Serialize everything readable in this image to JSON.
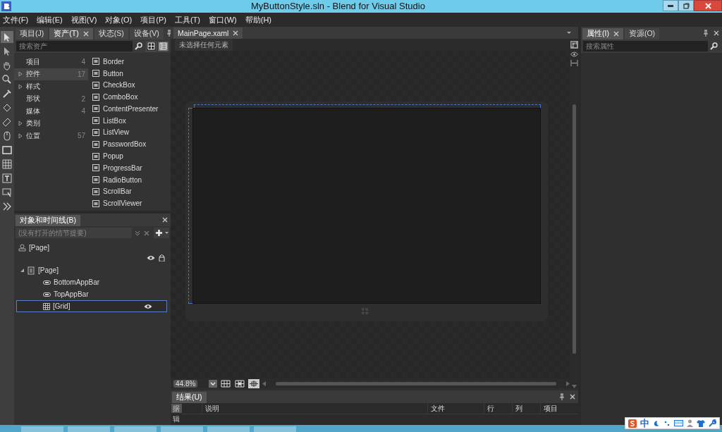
{
  "window": {
    "title": "MyButtonStyle.sln - Blend for Visual Studio"
  },
  "menu": [
    "文件(F)",
    "编辑(E)",
    "视图(V)",
    "对象(O)",
    "项目(P)",
    "工具(T)",
    "窗口(W)",
    "帮助(H)"
  ],
  "assets_panel": {
    "tabs": [
      {
        "label": "项目(J)",
        "selected": false
      },
      {
        "label": "资产(T)",
        "selected": true
      },
      {
        "label": "状态(S)",
        "selected": false
      },
      {
        "label": "设备(V)",
        "selected": false
      }
    ],
    "search": {
      "placeholder": "搜索资产"
    },
    "view_toggles": [
      {
        "kind": "grid",
        "selected": false
      },
      {
        "kind": "list",
        "selected": true
      }
    ],
    "categories": [
      {
        "label": "项目",
        "count": "4",
        "expandable": false,
        "selected": false
      },
      {
        "label": "控件",
        "count": "17",
        "expandable": true,
        "selected": true
      },
      {
        "label": "样式",
        "expandable": true,
        "selected": false
      },
      {
        "label": "形状",
        "count": "2",
        "expandable": false,
        "selected": false
      },
      {
        "label": "媒体",
        "count": "4",
        "expandable": false,
        "selected": false
      },
      {
        "label": "类别",
        "expandable": true,
        "selected": false
      },
      {
        "label": "位置",
        "count": "57",
        "expandable": true,
        "selected": false
      }
    ],
    "assets": [
      "Border",
      "Button",
      "CheckBox",
      "ComboBox",
      "ContentPresenter",
      "ListBox",
      "ListView",
      "PasswordBox",
      "Popup",
      "ProgressBar",
      "RadioButton",
      "ScrollBar",
      "ScrollViewer"
    ]
  },
  "objects_panel": {
    "title": "对象和时间线(B)",
    "storyboard": {
      "placeholder": "(没有打开的情节提要)"
    },
    "scope": "[Page]",
    "tree": [
      {
        "label": "[Page]",
        "expanded": true,
        "selected": false,
        "children": [
          {
            "label": "BottomAppBar",
            "selected": false
          },
          {
            "label": "TopAppBar",
            "selected": false
          },
          {
            "label": "[Grid]",
            "selected": true
          }
        ]
      }
    ]
  },
  "document": {
    "tab": "MainPage.xaml",
    "breadcrumb": "未选择任何元素",
    "zoom": "44.8%",
    "view_buttons": [
      {
        "kind": "grid",
        "selected": false
      },
      {
        "kind": "snap-grid",
        "selected": false
      },
      {
        "kind": "snap-lines",
        "selected": true
      }
    ]
  },
  "results_panel": {
    "title": "结果(U)",
    "side_tabs": [
      {
        "label": "据",
        "selected": true
      },
      {
        "label": "辑",
        "selected": false
      }
    ],
    "columns": [
      "说明",
      "文件",
      "行",
      "列",
      "项目"
    ]
  },
  "properties_panel": {
    "tabs": [
      {
        "label": "属性(I)",
        "selected": true
      },
      {
        "label": "资源(O)",
        "selected": false
      }
    ],
    "search": {
      "placeholder": "搜索属性"
    }
  },
  "ime_bar": {
    "mode": "中"
  }
}
